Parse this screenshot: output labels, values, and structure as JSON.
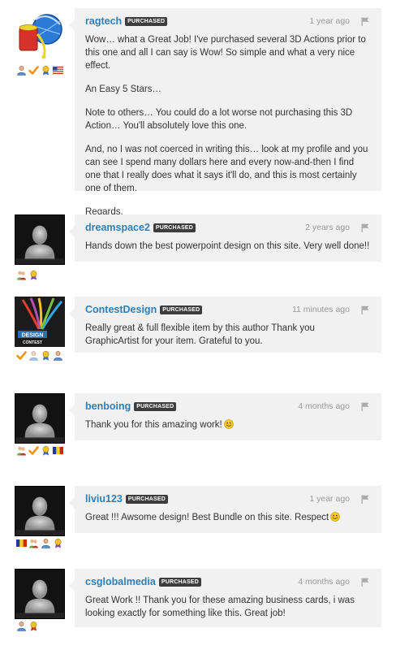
{
  "comments": [
    {
      "username": "ragtech",
      "badge": "PURCHASED",
      "time": "1 year ago",
      "paragraphs": [
        "Wow… what a Great Job! I've purchased several 3D Actions prior to this one and all I can say is Wow! So simple and what a very nice effect.",
        "An Easy 5 Stars…",
        "Note to others… You could do a lot worse not purchasing this 3D Action… You'll absolutely love this one.",
        "And, no I was not coerced in writing this… look at my profile and you can see I spend many dollars here and every now-and-then I find one that I really does what it says it'll do, and this is most certainly one of them.",
        "Regards,\n~ragtech"
      ]
    },
    {
      "username": "dreamspace2",
      "badge": "PURCHASED",
      "time": "2 years ago",
      "paragraphs": [
        "Hands down the best powerpoint design on this site. Very well done!!"
      ]
    },
    {
      "username": "ContestDesign",
      "badge": "PURCHASED",
      "time": "11 minutes ago",
      "paragraphs": [
        "Really great & full flexible item by this author Thank you GraphicArtist for your item. Grateful to you."
      ],
      "avatar_text": "DESIGN",
      "avatar_subtext": "CONTEST"
    },
    {
      "username": "benboing",
      "badge": "PURCHASED",
      "time": "4 months ago",
      "paragraphs": [
        "Thank you for this amazing work!"
      ]
    },
    {
      "username": "liviu123",
      "badge": "PURCHASED",
      "time": "1 year ago",
      "paragraphs": [
        "Great !!! Awsome design! Best Bundle on this site. Respect"
      ]
    },
    {
      "username": "csglobalmedia",
      "badge": "PURCHASED",
      "time": "4 months ago",
      "paragraphs": [
        "Great Work !! Thank you for these amazing business cards, i was looking exactly for something like this. Great job!"
      ]
    }
  ],
  "icons": {
    "flag": "flag-icon",
    "smiley": "smiley-icon",
    "author_badge": "author-badge-icon",
    "check_badge": "checkmark-badge-icon",
    "medal_badge": "medal-badge-icon",
    "usa_flag": "usa-flag-icon",
    "romania_flag": "romania-flag-icon"
  },
  "colors": {
    "username": "#2f7fb8",
    "bubble": "#f1f1f1",
    "purchased_bg": "#3d3d3d",
    "meta": "#999999"
  }
}
